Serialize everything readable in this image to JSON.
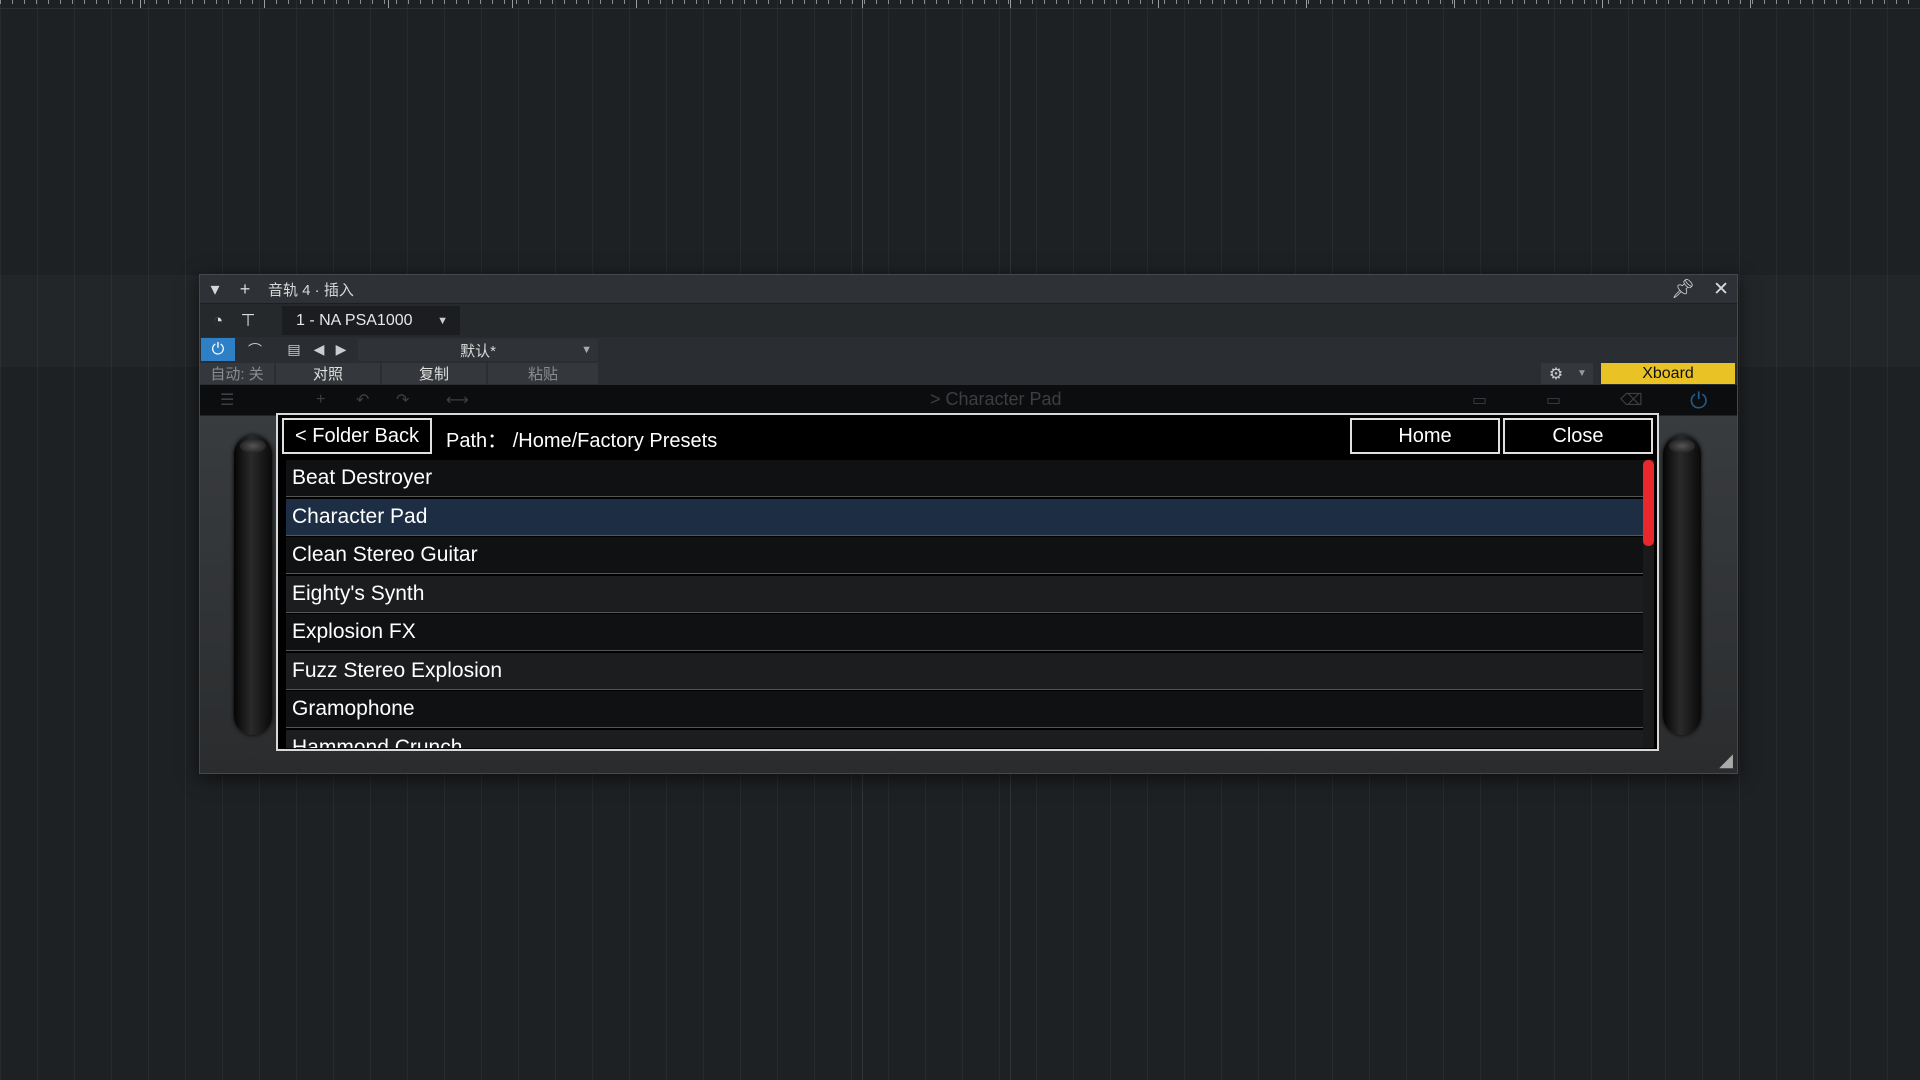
{
  "window": {
    "title": "音轨 4 · 插入",
    "plugin_slot": "1 - NA PSA1000",
    "preset_name": "默认*",
    "auto_label": "自动: 关",
    "compare_label": "对照",
    "copy_label": "复制",
    "paste_label": "粘贴",
    "xboard_label": "Xboard",
    "accent_color": "#2d7fc6",
    "xboard_color": "#e9c326"
  },
  "plugin": {
    "current_preset": "> Character Pad"
  },
  "browser": {
    "back_label": "< Folder Back",
    "path_label": "Path：",
    "path_value": "/Home/Factory Presets",
    "home_label": "Home",
    "close_label": "Close",
    "scroll_color": "#e8282a",
    "items": [
      {
        "label": "Beat Destroyer",
        "selected": false
      },
      {
        "label": "Character Pad",
        "selected": true
      },
      {
        "label": "Clean Stereo Guitar",
        "selected": false
      },
      {
        "label": "Eighty's Synth",
        "selected": false
      },
      {
        "label": "Explosion FX",
        "selected": false
      },
      {
        "label": "Fuzz Stereo Explosion",
        "selected": false
      },
      {
        "label": "Gramophone",
        "selected": false
      },
      {
        "label": "Hammond Crunch",
        "selected": false
      }
    ]
  }
}
